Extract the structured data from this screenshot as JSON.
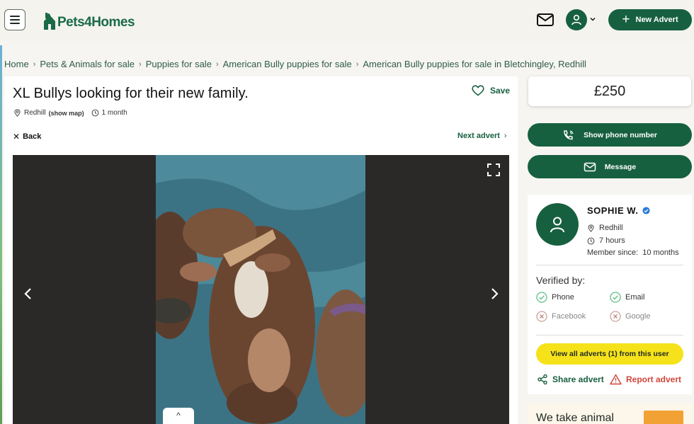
{
  "header": {
    "logo_text": "Pets4Homes",
    "new_advert_label": "New Advert",
    "brand_color": "#17603f"
  },
  "breadcrumb": [
    "Home",
    "Pets & Animals for sale",
    "Puppies for sale",
    "American Bully puppies for sale",
    "American Bully puppies for sale in Bletchingley, Redhill"
  ],
  "advert": {
    "title": "XL Bullys looking for their new family.",
    "save_label": "Save",
    "location": "Redhill",
    "show_map_label": "(show map)",
    "age": "1 month",
    "back_label": "Back",
    "next_label": "Next advert",
    "gallery_toggle": "^"
  },
  "sidebar": {
    "price": "£250",
    "show_phone_label": "Show phone number",
    "message_label": "Message"
  },
  "seller": {
    "name": "SOPHIE W.",
    "location": "Redhill",
    "last_seen": "7 hours",
    "member_since": "Member since:  10 months",
    "verified_title": "Verified by:",
    "verifications": [
      {
        "label": "Phone",
        "verified": true
      },
      {
        "label": "Email",
        "verified": true
      },
      {
        "label": "Facebook",
        "verified": false
      },
      {
        "label": "Google",
        "verified": false
      }
    ],
    "view_all_label": "View all adverts (1) from this user",
    "share_label": "Share advert",
    "report_label": "Report advert"
  },
  "promo": {
    "text": "We take animal"
  }
}
